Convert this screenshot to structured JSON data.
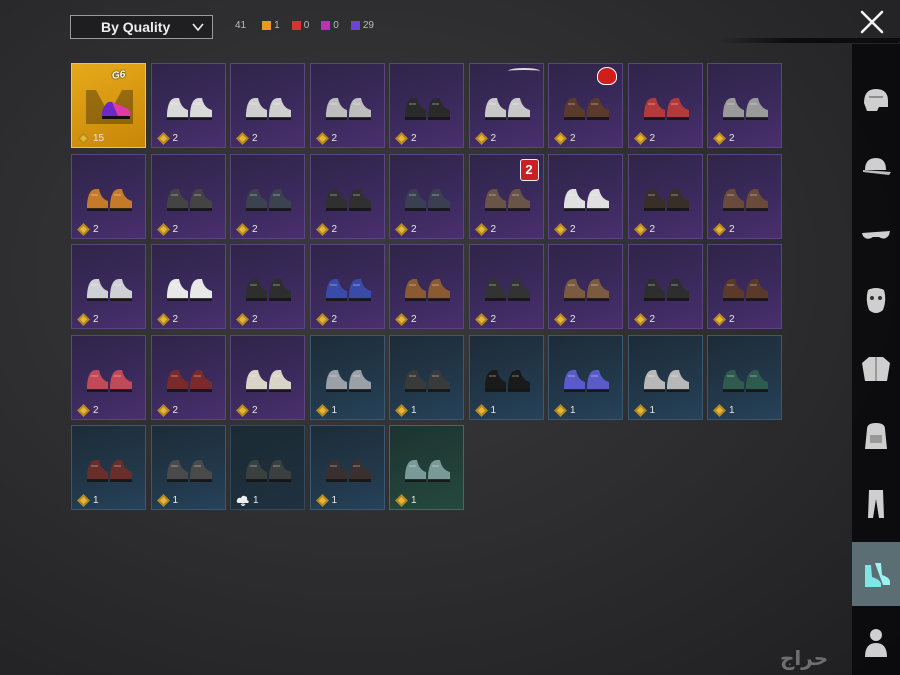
{
  "toolbar": {
    "sort_label": "By Quality",
    "total_count": "41",
    "quality_counts": [
      {
        "color": "#e79a1c",
        "value": "1"
      },
      {
        "color": "#d93232",
        "value": "0"
      },
      {
        "color": "#c22fb5",
        "value": "0"
      },
      {
        "color": "#6a44d8",
        "value": "29"
      }
    ]
  },
  "items": [
    {
      "quality": "gold",
      "count": "15",
      "tag": "G6"
    },
    {
      "quality": "purple",
      "count": "2",
      "color": "#d9d9d9"
    },
    {
      "quality": "purple",
      "count": "2",
      "color": "#cfcfcf"
    },
    {
      "quality": "purple",
      "count": "2",
      "color": "#bdbdbd"
    },
    {
      "quality": "purple",
      "count": "2",
      "color": "#2a2a2a"
    },
    {
      "quality": "purple",
      "count": "2",
      "color": "#c8c8c8",
      "badge": "wings"
    },
    {
      "quality": "purple",
      "count": "2",
      "color": "#5a3a2a",
      "badge": "logo"
    },
    {
      "quality": "purple",
      "count": "2",
      "color": "#b23a3a"
    },
    {
      "quality": "purple",
      "count": "2",
      "color": "#9a9a9a"
    },
    {
      "quality": "purple",
      "count": "2",
      "color": "#c57a2a"
    },
    {
      "quality": "purple",
      "count": "2",
      "color": "#444"
    },
    {
      "quality": "purple",
      "count": "2",
      "color": "#3c4250"
    },
    {
      "quality": "purple",
      "count": "2",
      "color": "#303030"
    },
    {
      "quality": "purple",
      "count": "2",
      "color": "#3a3f52"
    },
    {
      "quality": "purple",
      "count": "2",
      "color": "#6a5448",
      "badge": "2"
    },
    {
      "quality": "purple",
      "count": "2",
      "color": "#e0e0e0"
    },
    {
      "quality": "purple",
      "count": "2",
      "color": "#3a2e28"
    },
    {
      "quality": "purple",
      "count": "2",
      "color": "#6a4a3a"
    },
    {
      "quality": "purple",
      "count": "2",
      "color": "#cfcfd6"
    },
    {
      "quality": "purple",
      "count": "2",
      "color": "#e8e8e8"
    },
    {
      "quality": "purple",
      "count": "2",
      "color": "#2e2e2e"
    },
    {
      "quality": "purple",
      "count": "2",
      "color": "#3a4aa8"
    },
    {
      "quality": "purple",
      "count": "2",
      "color": "#8a5a30"
    },
    {
      "quality": "purple",
      "count": "2",
      "color": "#333"
    },
    {
      "quality": "purple",
      "count": "2",
      "color": "#7a5a40"
    },
    {
      "quality": "purple",
      "count": "2",
      "color": "#2e2e2e"
    },
    {
      "quality": "purple",
      "count": "2",
      "color": "#5a3a2a"
    },
    {
      "quality": "purple",
      "count": "2",
      "color": "#c04a58"
    },
    {
      "quality": "purple",
      "count": "2",
      "color": "#7a2a2a"
    },
    {
      "quality": "purple",
      "count": "2",
      "color": "#d8d4c8"
    },
    {
      "quality": "blue",
      "count": "1",
      "color": "#9aa0a8"
    },
    {
      "quality": "blue",
      "count": "1",
      "color": "#3a3a3a"
    },
    {
      "quality": "blue",
      "count": "1",
      "color": "#1a1a1a"
    },
    {
      "quality": "blue",
      "count": "1",
      "color": "#5a5ac8"
    },
    {
      "quality": "blue",
      "count": "1",
      "color": "#b8b8b8"
    },
    {
      "quality": "blue",
      "count": "1",
      "color": "#2f5a4e"
    },
    {
      "quality": "blue",
      "count": "1",
      "color": "#6a2e2a"
    },
    {
      "quality": "blue",
      "count": "1",
      "color": "#4a4a4a"
    },
    {
      "quality": "dark",
      "count": "1",
      "color": "#3a4040",
      "cloud": true
    },
    {
      "quality": "blue",
      "count": "1",
      "color": "#3a3030"
    },
    {
      "quality": "green",
      "count": "1",
      "color": "#7a9a9a"
    }
  ],
  "sidebar": [
    {
      "name": "helmet-icon",
      "active": false
    },
    {
      "name": "cap-icon",
      "active": false
    },
    {
      "name": "glasses-icon",
      "active": false
    },
    {
      "name": "mask-icon",
      "active": false
    },
    {
      "name": "jacket-icon",
      "active": false
    },
    {
      "name": "backpack-icon",
      "active": false
    },
    {
      "name": "pants-icon",
      "active": false
    },
    {
      "name": "shoes-icon",
      "active": true
    },
    {
      "name": "character-icon",
      "active": false
    }
  ],
  "watermark": "حراج"
}
